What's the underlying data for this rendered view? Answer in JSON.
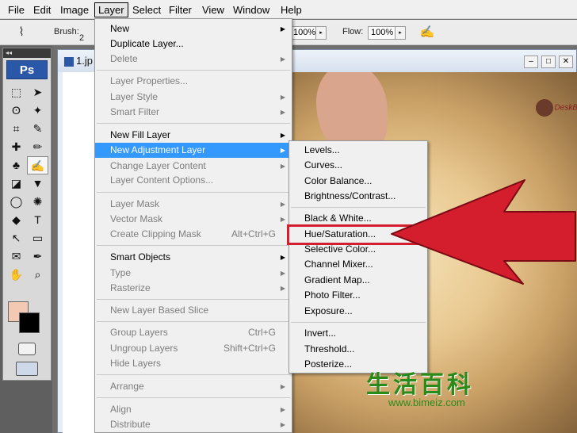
{
  "menubar": [
    "File",
    "Edit",
    "Image",
    "Layer",
    "Select",
    "Filter",
    "View",
    "Window",
    "Help"
  ],
  "options": {
    "brush_label": "Brush:",
    "brush_value": "2",
    "opacity_value": "100%",
    "flow_label": "Flow:",
    "flow_value": "100%"
  },
  "tools": {
    "header": "◂◂",
    "ps_logo": "Ps",
    "items": [
      "⬚",
      "➤",
      "ʘ",
      "✦",
      "⌗",
      "✎",
      "✚",
      "✏",
      "♣",
      "✍",
      "◪",
      "▼",
      "◯",
      "✺",
      "◆",
      "T",
      "↖",
      "▭",
      "✉",
      "✒",
      "✋",
      "⌕"
    ]
  },
  "document": {
    "tab": "1.jp",
    "logo_text": "DeskB"
  },
  "layer_menu": {
    "items": [
      {
        "label": "New",
        "submenu": true,
        "disabled": false
      },
      {
        "label": "Duplicate Layer...",
        "disabled": false
      },
      {
        "label": "Delete",
        "submenu": true,
        "disabled": true
      },
      {
        "label": "Layer Properties...",
        "disabled": true
      },
      {
        "label": "Layer Style",
        "submenu": true,
        "disabled": true
      },
      {
        "label": "Smart Filter",
        "submenu": true,
        "disabled": true
      },
      {
        "label": "New Fill Layer",
        "submenu": true,
        "disabled": false
      },
      {
        "label": "New Adjustment Layer",
        "submenu": true,
        "disabled": false,
        "highlighted": true
      },
      {
        "label": "Change Layer Content",
        "submenu": true,
        "disabled": true
      },
      {
        "label": "Layer Content Options...",
        "disabled": true
      },
      {
        "label": "Layer Mask",
        "submenu": true,
        "disabled": true
      },
      {
        "label": "Vector Mask",
        "submenu": true,
        "disabled": true
      },
      {
        "label": "Create Clipping Mask",
        "shortcut": "Alt+Ctrl+G",
        "disabled": true
      },
      {
        "label": "Smart Objects",
        "submenu": true,
        "disabled": false
      },
      {
        "label": "Type",
        "submenu": true,
        "disabled": true
      },
      {
        "label": "Rasterize",
        "submenu": true,
        "disabled": true
      },
      {
        "label": "New Layer Based Slice",
        "disabled": true
      },
      {
        "label": "Group Layers",
        "shortcut": "Ctrl+G",
        "disabled": true
      },
      {
        "label": "Ungroup Layers",
        "shortcut": "Shift+Ctrl+G",
        "disabled": true
      },
      {
        "label": "Hide Layers",
        "disabled": true
      },
      {
        "label": "Arrange",
        "submenu": true,
        "disabled": true
      },
      {
        "label": "Align",
        "submenu": true,
        "disabled": true
      },
      {
        "label": "Distribute",
        "submenu": true,
        "disabled": true
      }
    ]
  },
  "adjustment_menu": {
    "items": [
      "Levels...",
      "Curves...",
      "Color Balance...",
      "Brightness/Contrast...",
      "Black & White...",
      "Hue/Saturation...",
      "Selective Color...",
      "Channel Mixer...",
      "Gradient Map...",
      "Photo Filter...",
      "Exposure...",
      "Invert...",
      "Threshold...",
      "Posterize..."
    ],
    "highlighted": "Hue/Saturation..."
  },
  "watermark": {
    "chinese": "生活百科",
    "url": "www.bimeiz.com"
  },
  "colors": {
    "highlight": "#3399ff",
    "callout_red": "#d41d2d",
    "ps_blue": "#2b57a8",
    "foreground_swatch": "#f4c9b4",
    "background_swatch": "#000000"
  }
}
